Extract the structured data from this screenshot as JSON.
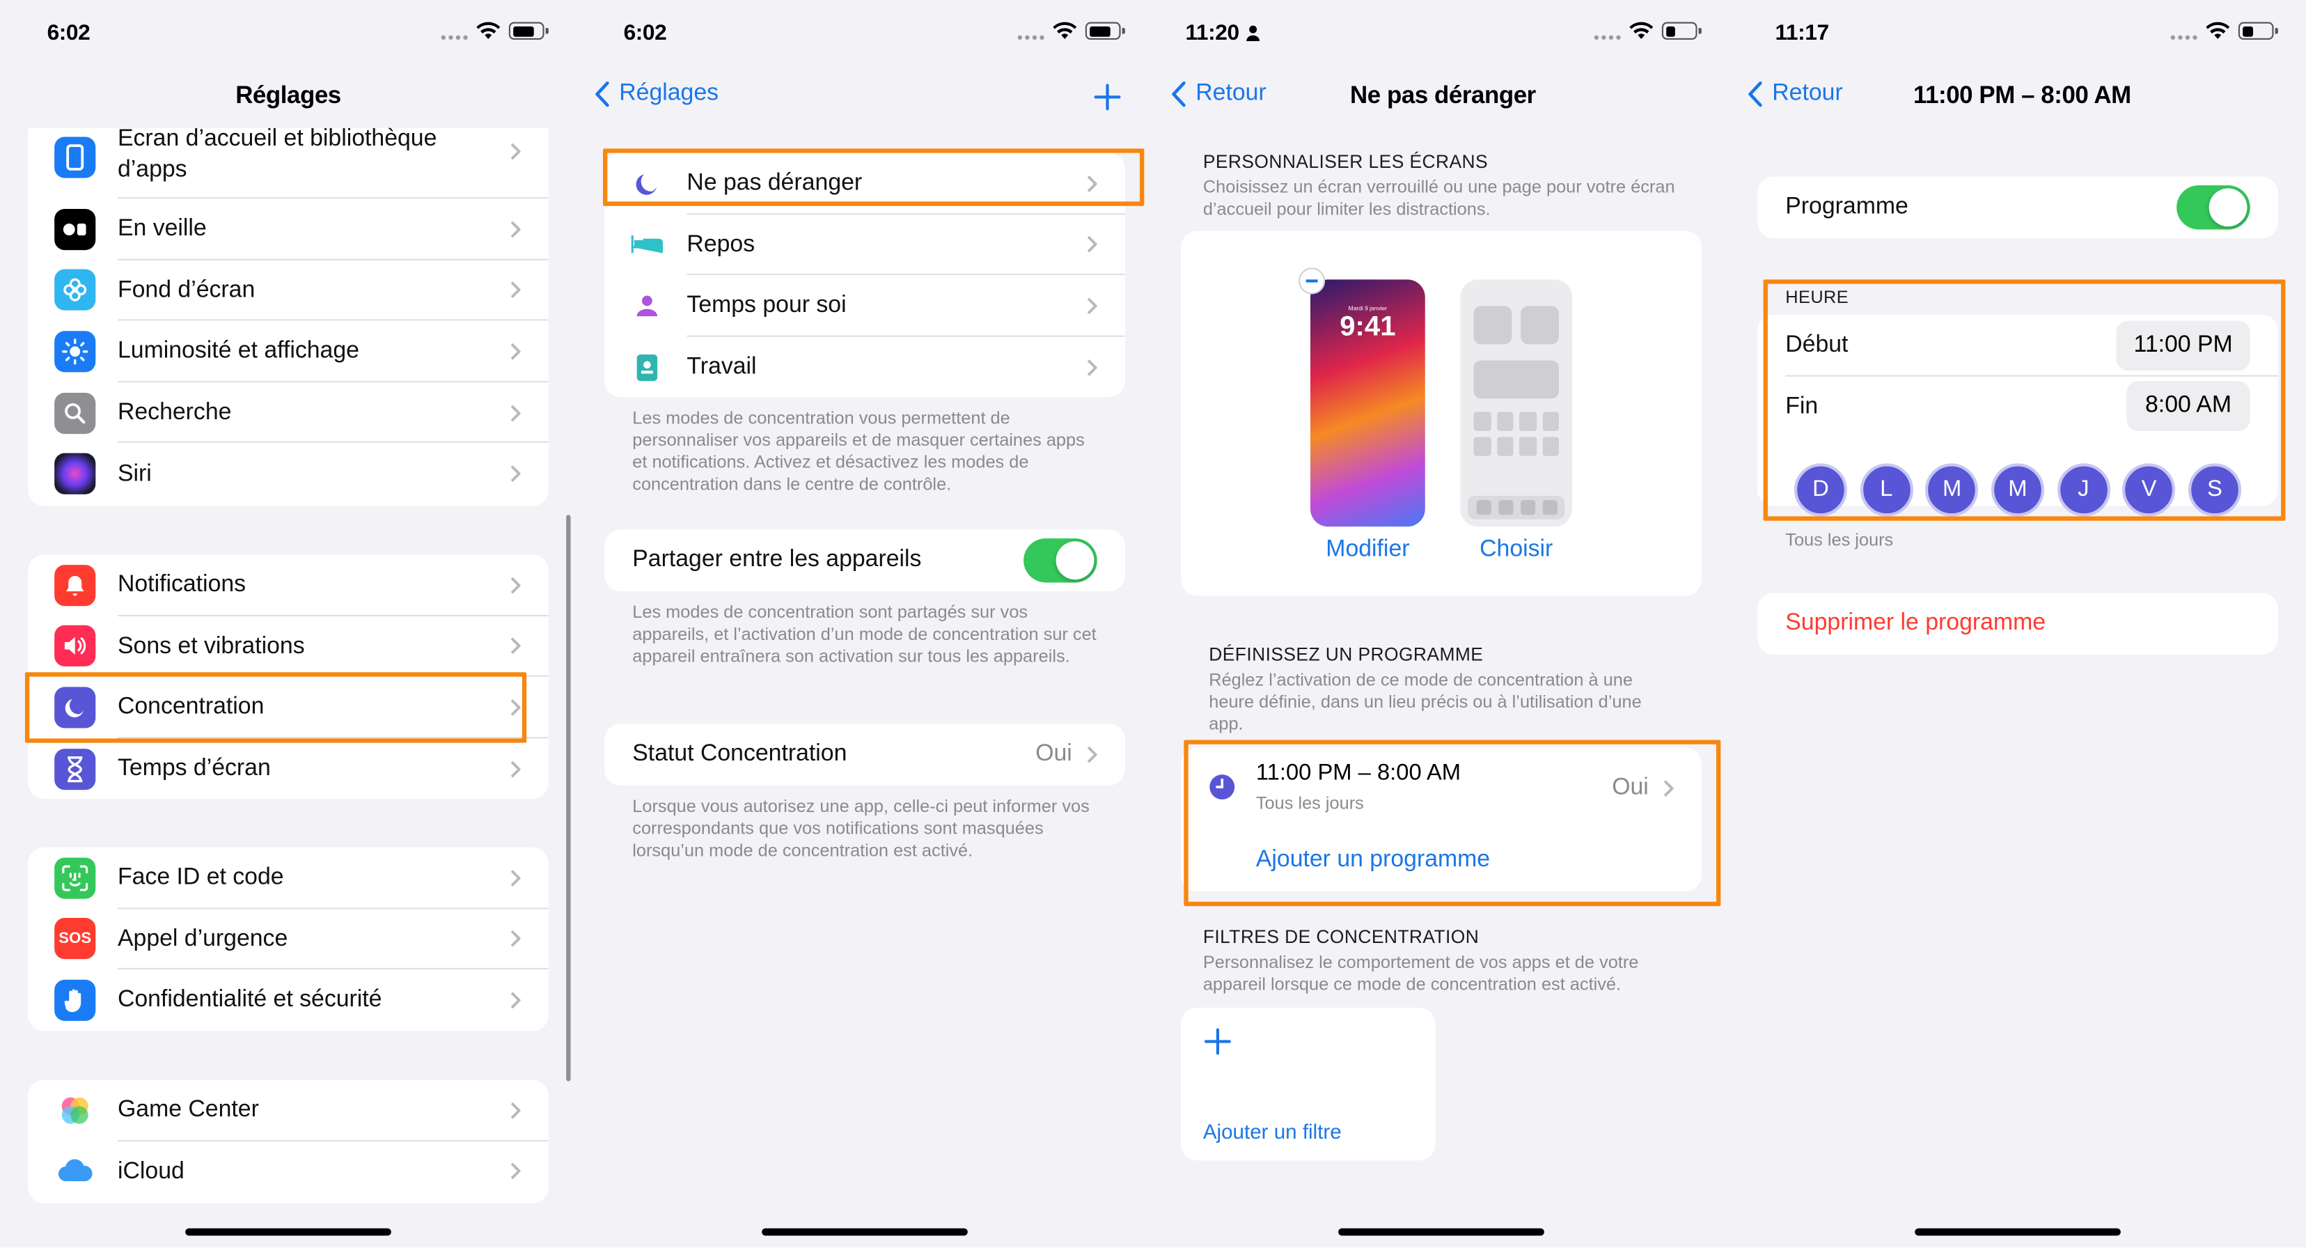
{
  "colors": {
    "accent": "#1a76e8",
    "highlight": "#f7870f",
    "toggle_on": "#34c759",
    "focus_purple": "#5856d6",
    "destructive": "#ff3b30"
  },
  "p1": {
    "time": "6:02",
    "title": "Réglages",
    "group1": [
      {
        "label": "Écran d’accueil et bibliothèque d’apps",
        "icon": "home-screen-icon"
      },
      {
        "label": "En veille",
        "icon": "standby-icon"
      },
      {
        "label": "Fond d’écran",
        "icon": "wallpaper-icon"
      },
      {
        "label": "Luminosité et affichage",
        "icon": "brightness-icon"
      },
      {
        "label": "Recherche",
        "icon": "search-icon"
      },
      {
        "label": "Siri",
        "icon": "siri-icon"
      }
    ],
    "group2": [
      {
        "label": "Notifications",
        "icon": "notifications-icon"
      },
      {
        "label": "Sons et vibrations",
        "icon": "sounds-icon"
      },
      {
        "label": "Concentration",
        "icon": "moon-icon"
      },
      {
        "label": "Temps d’écran",
        "icon": "hourglass-icon"
      }
    ],
    "group3": [
      {
        "label": "Face ID et code",
        "icon": "face-id-icon"
      },
      {
        "label": "Appel d’urgence",
        "icon": "sos-icon",
        "badge": "SOS"
      },
      {
        "label": "Confidentialité et sécurité",
        "icon": "hand-icon"
      }
    ],
    "group4": [
      {
        "label": "Game Center",
        "icon": "game-center-icon"
      },
      {
        "label": "iCloud",
        "icon": "icloud-icon"
      }
    ]
  },
  "p2": {
    "time": "6:02",
    "back": "Réglages",
    "modes": [
      {
        "label": "Ne pas déranger",
        "icon": "moon-icon"
      },
      {
        "label": "Repos",
        "icon": "bed-icon"
      },
      {
        "label": "Temps pour soi",
        "icon": "person-icon"
      },
      {
        "label": "Travail",
        "icon": "badge-icon"
      }
    ],
    "footer1": "Les modes de concentration vous permettent de personnaliser vos appareils et de masquer certaines apps et notifications. Activez et désactivez les modes de concentration dans le centre de contrôle.",
    "share_label": "Partager entre les appareils",
    "share_on": true,
    "footer2": "Les modes de concentration sont partagés sur vos appareils, et l’activation d’un mode de concentration sur cet appareil entraînera son activation sur tous les appareils.",
    "status_label": "Statut Concentration",
    "status_value": "Oui",
    "footer3": "Lorsque vous autorisez une app, celle-ci peut informer vos correspondants que vos notifications sont masquées lorsqu’un mode de concentration est activé."
  },
  "p3": {
    "time": "11:20",
    "back": "Retour",
    "title": "Ne pas déranger",
    "screens_head": "PERSONNALISER LES ÉCRANS",
    "screens_desc": "Choisissez un écran verrouillé ou une page pour votre écran d’accueil pour limiter les distractions.",
    "lock_date": "Mardi 9 janvier",
    "lock_time": "9:41",
    "modify": "Modifier",
    "choose": "Choisir",
    "prog_head": "DÉFINISSEZ UN PROGRAMME",
    "prog_desc": "Réglez l’activation de ce mode de concentration à une heure définie, dans un lieu précis ou à l’utilisation d’une app.",
    "schedule_time": "11:00 PM – 8:00 AM",
    "schedule_days": "Tous les jours",
    "schedule_value": "Oui",
    "add_schedule": "Ajouter un programme",
    "filters_head": "FILTRES DE CONCENTRATION",
    "filters_desc": "Personnalisez le comportement de vos apps et de votre appareil lorsque ce mode de concentration est activé.",
    "add_filter": "Ajouter un filtre"
  },
  "p4": {
    "time": "11:17",
    "back": "Retour",
    "title": "11:00 PM – 8:00 AM",
    "program_label": "Programme",
    "program_on": true,
    "hour_head": "HEURE",
    "start_label": "Début",
    "start_value": "11:00 PM",
    "end_label": "Fin",
    "end_value": "8:00 AM",
    "days": [
      "D",
      "L",
      "M",
      "M",
      "J",
      "V",
      "S"
    ],
    "days_footer": "Tous les jours",
    "delete": "Supprimer le programme"
  }
}
